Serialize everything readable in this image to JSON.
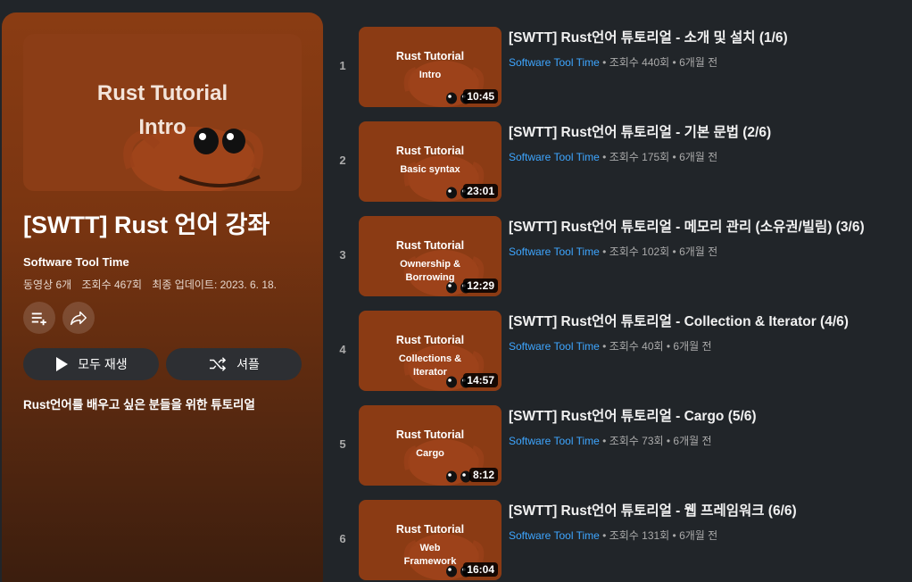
{
  "playlist": {
    "hero_line1": "Rust Tutorial",
    "hero_line2": "Intro",
    "title": "[SWTT] Rust 언어 강좌",
    "owner": "Software Tool Time",
    "video_count": "동영상 6개",
    "views": "조회수 467회",
    "updated": "최종 업데이트: 2023. 6. 18.",
    "play_all": "모두 재생",
    "shuffle": "셔플",
    "description": "Rust언어를 배우고 싶은 분들을 위한 튜토리얼",
    "add_icon": "playlist-add-icon",
    "share_icon": "share-icon"
  },
  "videos": [
    {
      "index": "1",
      "thumb_title": "Rust Tutorial",
      "thumb_sub": "Intro",
      "duration": "10:45",
      "title": "[SWTT] Rust언어 튜토리얼 - 소개 및 설치 (1/6)",
      "channel": "Software Tool Time",
      "stats": " • 조회수 440회 • 6개월 전"
    },
    {
      "index": "2",
      "thumb_title": "Rust Tutorial",
      "thumb_sub": "Basic syntax",
      "duration": "23:01",
      "title": "[SWTT] Rust언어 튜토리얼 - 기본 문법 (2/6)",
      "channel": "Software Tool Time",
      "stats": " • 조회수 175회 • 6개월 전"
    },
    {
      "index": "3",
      "thumb_title": "Rust Tutorial",
      "thumb_sub": "Ownership &\nBorrowing",
      "duration": "12:29",
      "title": "[SWTT] Rust언어 튜토리얼 - 메모리 관리 (소유권/빌림) (3/6)",
      "channel": "Software Tool Time",
      "stats": " • 조회수 102회 • 6개월 전"
    },
    {
      "index": "4",
      "thumb_title": "Rust Tutorial",
      "thumb_sub": "Collections &\nIterator",
      "duration": "14:57",
      "title": "[SWTT] Rust언어 튜토리얼 - Collection & Iterator (4/6)",
      "channel": "Software Tool Time",
      "stats": " • 조회수 40회 • 6개월 전"
    },
    {
      "index": "5",
      "thumb_title": "Rust Tutorial",
      "thumb_sub": "Cargo",
      "duration": "8:12",
      "title": "[SWTT] Rust언어 튜토리얼 - Cargo (5/6)",
      "channel": "Software Tool Time",
      "stats": " • 조회수 73회 • 6개월 전"
    },
    {
      "index": "6",
      "thumb_title": "Rust Tutorial",
      "thumb_sub": "Web\nFramework",
      "duration": "16:04",
      "title": "[SWTT] Rust언어 튜토리얼 - 웹 프레임워크 (6/6)",
      "channel": "Software Tool Time",
      "stats": " • 조회수 131회 • 6개월 전"
    }
  ],
  "colors": {
    "background": "#212529",
    "panel_top": "#8a3c13",
    "panel_bottom": "#3a1d0e",
    "channel_link": "#3ea6ff",
    "thumb_bg": "#8b3b14"
  }
}
